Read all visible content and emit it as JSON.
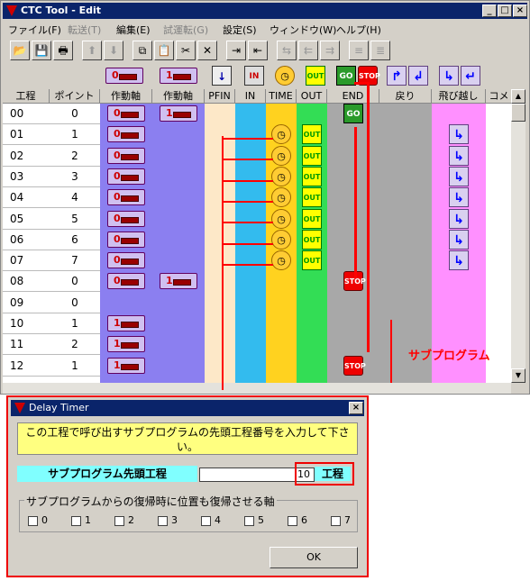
{
  "window": {
    "title": "CTC Tool - Edit",
    "min": "_",
    "max": "□",
    "close": "×"
  },
  "menu": [
    {
      "label": "ファイル(F)",
      "disabled": false
    },
    {
      "label": "転送(T)",
      "disabled": true
    },
    {
      "label": "編集(E)",
      "disabled": false
    },
    {
      "label": "試運転(G)",
      "disabled": true
    },
    {
      "label": "設定(S)",
      "disabled": false
    },
    {
      "label": "ウィンドウ(W)",
      "disabled": false
    },
    {
      "label": "ヘルプ(H)",
      "disabled": false
    }
  ],
  "toolbar_icons": [
    "open-icon",
    "save-icon",
    "print-icon",
    "arrow-up-icon",
    "arrow-down-icon",
    "copy-icon",
    "paste-icon",
    "cut-icon",
    "delete-icon",
    "insert-row-icon",
    "append-row-icon",
    "indent-icon",
    "outdent-icon",
    "unindent-icon",
    "stack-icon",
    "stack-down-icon"
  ],
  "palette": [
    "axis-0-icon",
    "axis-1-icon",
    "pfin-icon",
    "in-icon",
    "timer-icon",
    "out-icon",
    "go-icon",
    "stop-icon",
    "jump-icon",
    "return-icon",
    "jump-down-icon",
    "return-left-icon"
  ],
  "palette_text": {
    "in": "IN",
    "out": "OUT",
    "go": "GO",
    "stop": "STOP"
  },
  "grid": {
    "headers": [
      "工程",
      "ポイント",
      "作動軸",
      "作動軸",
      "PFIN",
      "IN",
      "TIME",
      "OUT",
      "END",
      "戻り",
      "飛び越し",
      "コメ"
    ],
    "rows": [
      {
        "step": "00",
        "point": "0",
        "axis1": "0",
        "axis2": "1",
        "time": false,
        "out": false,
        "end": "GO",
        "jump": false
      },
      {
        "step": "01",
        "point": "1",
        "axis1": "0",
        "axis2": "",
        "time": true,
        "out": true,
        "end": "",
        "jump": true
      },
      {
        "step": "02",
        "point": "2",
        "axis1": "0",
        "axis2": "",
        "time": true,
        "out": true,
        "end": "",
        "jump": true
      },
      {
        "step": "03",
        "point": "3",
        "axis1": "0",
        "axis2": "",
        "time": true,
        "out": true,
        "end": "",
        "jump": true
      },
      {
        "step": "04",
        "point": "4",
        "axis1": "0",
        "axis2": "",
        "time": true,
        "out": true,
        "end": "",
        "jump": true
      },
      {
        "step": "05",
        "point": "5",
        "axis1": "0",
        "axis2": "",
        "time": true,
        "out": true,
        "end": "",
        "jump": true
      },
      {
        "step": "06",
        "point": "6",
        "axis1": "0",
        "axis2": "",
        "time": true,
        "out": true,
        "end": "",
        "jump": true
      },
      {
        "step": "07",
        "point": "7",
        "axis1": "0",
        "axis2": "",
        "time": true,
        "out": true,
        "end": "",
        "jump": true
      },
      {
        "step": "08",
        "point": "0",
        "axis1": "0",
        "axis2": "1",
        "time": false,
        "out": false,
        "end": "STOP",
        "jump": false
      },
      {
        "step": "09",
        "point": "0",
        "axis1": "",
        "axis2": "",
        "time": false,
        "out": false,
        "end": "",
        "jump": false
      },
      {
        "step": "10",
        "point": "1",
        "axis1": "1",
        "axis2": "",
        "time": false,
        "out": false,
        "end": "",
        "jump": false
      },
      {
        "step": "11",
        "point": "2",
        "axis1": "1",
        "axis2": "",
        "time": false,
        "out": false,
        "end": "",
        "jump": false
      },
      {
        "step": "12",
        "point": "1",
        "axis1": "1",
        "axis2": "",
        "time": false,
        "out": false,
        "end": "STOP",
        "jump": false
      }
    ]
  },
  "annotation": {
    "label": "サブプログラム"
  },
  "dialog": {
    "title": "Delay Timer",
    "close": "×",
    "message": "この工程で呼び出すサブプログラムの先頭工程番号を入力して下さい。",
    "field_label": "サブプログラム先頭工程",
    "field_value": "10",
    "field_unit": "工程",
    "group_label": "サブプログラムからの復帰時に位置も復帰させる軸",
    "axes": [
      "0",
      "1",
      "2",
      "3",
      "4",
      "5",
      "6",
      "7"
    ],
    "ok": "OK"
  }
}
